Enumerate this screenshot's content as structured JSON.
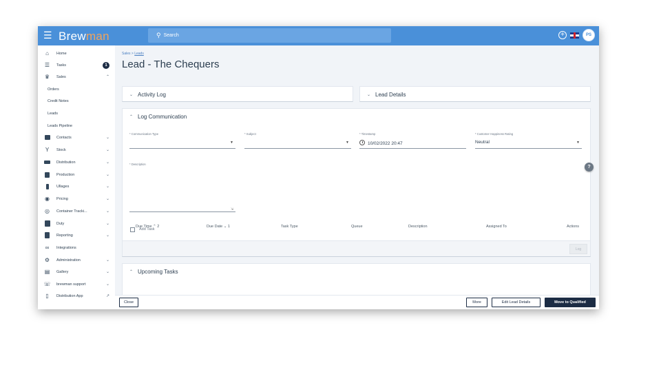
{
  "app": {
    "logo_main": "Brew",
    "logo_accent": "man",
    "search_placeholder": "Search",
    "user_initials": "PS"
  },
  "sidebar": {
    "items": [
      {
        "label": "Home",
        "icon": "home-icon"
      },
      {
        "label": "Tasks",
        "icon": "list-icon",
        "badge": "1"
      },
      {
        "label": "Sales",
        "icon": "cart-icon",
        "chevron": "up"
      },
      {
        "label": "Orders",
        "sub": true
      },
      {
        "label": "Credit Notes",
        "sub": true
      },
      {
        "label": "Leads",
        "sub": true
      },
      {
        "label": "Leads Pipeline",
        "sub": true
      },
      {
        "label": "Contacts",
        "icon": "contacts-icon",
        "chevron": "down"
      },
      {
        "label": "Stock",
        "icon": "stock-icon",
        "chevron": "down"
      },
      {
        "label": "Distribution",
        "icon": "truck-icon",
        "chevron": "down"
      },
      {
        "label": "Production",
        "icon": "production-icon",
        "chevron": "down"
      },
      {
        "label": "Ullages",
        "icon": "ullages-icon",
        "chevron": "down"
      },
      {
        "label": "Pricing",
        "icon": "pricing-icon",
        "chevron": "down"
      },
      {
        "label": "Container Tracki...",
        "icon": "container-icon",
        "chevron": "down"
      },
      {
        "label": "Duty",
        "icon": "duty-icon",
        "chevron": "down"
      },
      {
        "label": "Reporting",
        "icon": "report-icon",
        "chevron": "down"
      },
      {
        "label": "Integrations",
        "icon": "link-icon"
      },
      {
        "label": "Administration",
        "icon": "gear-icon",
        "chevron": "down"
      },
      {
        "label": "Gallery",
        "icon": "gallery-icon",
        "chevron": "down"
      },
      {
        "label": "brewman support",
        "icon": "support-icon",
        "chevron": "down"
      },
      {
        "label": "Distribution App",
        "icon": "phone-icon"
      }
    ]
  },
  "breadcrumb": {
    "prefix": "Sales > ",
    "link": "Leads"
  },
  "page_title": "Lead - The Chequers",
  "panels": {
    "activity_log": "Activity Log",
    "lead_details": "Lead Details",
    "log_communication": "Log Communication",
    "upcoming_tasks": "Upcoming Tasks"
  },
  "form": {
    "communication_type_label": "* Communication Type",
    "subject_label": "* Subject",
    "timestamp_label": "* Timestamp",
    "timestamp_value": "10/02/2022 20:47",
    "happiness_label": "* Customer Happiness Rating",
    "happiness_value": "Neutral",
    "description_label": "* Description",
    "add_task_label": "Add Task",
    "log_button": "Log"
  },
  "tasks_table": {
    "columns": [
      "Due Time ⌃ 2",
      "Due Date ⌄ 1",
      "Task Type",
      "Queue",
      "Description",
      "Assigned To",
      "Actions"
    ]
  },
  "footer": {
    "close": "Close",
    "more": "More",
    "edit": "Edit Lead Details",
    "qualify": "Move to Qualified"
  }
}
